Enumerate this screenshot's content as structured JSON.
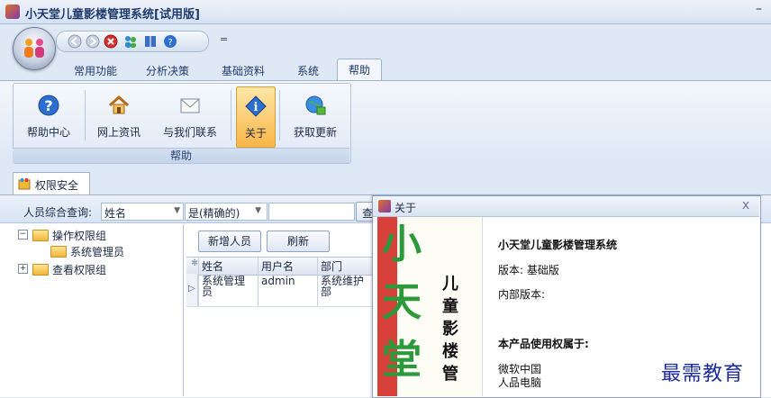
{
  "window": {
    "title": "小天堂儿童影楼管理系统[试用版]",
    "minimize": "–"
  },
  "qat": {
    "dropdown": "="
  },
  "tabs": [
    {
      "label": "常用功能"
    },
    {
      "label": "分析决策"
    },
    {
      "label": "基础资料"
    },
    {
      "label": "系统"
    },
    {
      "label": "帮助",
      "active": true
    }
  ],
  "ribbon": {
    "group_label": "帮助",
    "buttons": [
      {
        "label": "帮助中心",
        "icon": "help-icon"
      },
      {
        "label": "网上资讯",
        "icon": "home-icon"
      },
      {
        "label": "与我们联系",
        "icon": "envelope-icon"
      },
      {
        "label": "关于",
        "icon": "info-icon",
        "active": true
      },
      {
        "label": "获取更新",
        "icon": "globe-update-icon"
      }
    ]
  },
  "doc_tab": {
    "label": "权限安全"
  },
  "search": {
    "label": "人员综合查询:",
    "field_value": "姓名",
    "match_value": "是(精确的)",
    "query_value": "",
    "button_label": "查询"
  },
  "tree": {
    "nodes": [
      {
        "label": "操作权限组",
        "expander": "−"
      },
      {
        "label": "系统管理员"
      },
      {
        "label": "查看权限组",
        "expander": "+"
      }
    ]
  },
  "grid": {
    "add_button": "新增人员",
    "refresh_button": "刷新",
    "columns": [
      "姓名",
      "用户名",
      "部门"
    ],
    "rows": [
      {
        "name": "系统管理员",
        "username": "admin",
        "dept": "系统维护部"
      }
    ]
  },
  "about": {
    "title": "关于",
    "close": "x",
    "art_big": [
      "小",
      "天",
      "堂"
    ],
    "art_small": [
      "儿",
      "童",
      "影",
      "楼",
      "管"
    ],
    "product": "小天堂儿童影楼管理系统",
    "version": "版本: 基础版",
    "internal_version": "内部版本:",
    "rights_label": "本产品使用权属于:",
    "owner_1": "微软中国",
    "owner_2": "人品电脑"
  },
  "watermark": "最需教育"
}
